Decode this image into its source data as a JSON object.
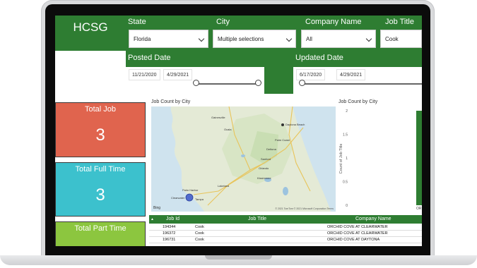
{
  "logo": "HCSG",
  "filters": {
    "state": {
      "label": "State",
      "value": "Florida"
    },
    "city": {
      "label": "City",
      "value": "Multiple selections"
    },
    "company": {
      "label": "Company Name",
      "value": "All"
    },
    "job_title": {
      "label": "Job Title",
      "value": "Cook"
    }
  },
  "posted_date": {
    "label": "Posted Date",
    "from": "11/21/2020",
    "to": "4/29/2021"
  },
  "updated_date": {
    "label": "Updated Date",
    "from": "6/17/2020",
    "to": "4/29/2021"
  },
  "cards": [
    {
      "title": "Total Job",
      "value": "3",
      "color": "#e0644e"
    },
    {
      "title": "Total Full Time",
      "value": "3",
      "color": "#3cc1cd"
    },
    {
      "title": "Total Part Time",
      "value": "",
      "color": "#8cc63f"
    }
  ],
  "map": {
    "title": "Job Count by City",
    "attribution": "Bing",
    "copyright": "© 2021 TomTom © 2021 Microsoft Corporation Terms",
    "cities": [
      "Daytona Beach",
      "Ocala",
      "Deltona",
      "Sanford",
      "Orlando",
      "Kissimmee",
      "Lakeland",
      "Palm Harbor",
      "Clearwater",
      "Tampa",
      "Gainesville",
      "Palm Coast"
    ]
  },
  "chart_data": {
    "type": "bar",
    "title": "Job Count by City",
    "ylabel": "Count of Job Title",
    "categories": [
      "ORLANDO"
    ],
    "values": [
      2
    ],
    "ylim": [
      0,
      2
    ],
    "yticks": [
      "0",
      "0.5",
      "1",
      "1.5",
      "2"
    ],
    "visible_tick_label": "OR",
    "color": "#2e7d32"
  },
  "table": {
    "columns": [
      "Job Id",
      "Job Title",
      "Company Name"
    ],
    "rows": [
      [
        "194344",
        "Cook",
        "ORCHID COVE AT CLEARWATER"
      ],
      [
        "196372",
        "Cook",
        "ORCHID COVE AT CLEARWATER"
      ],
      [
        "196731",
        "Cook",
        "ORCHID COVE AT DAYTONA"
      ]
    ]
  }
}
